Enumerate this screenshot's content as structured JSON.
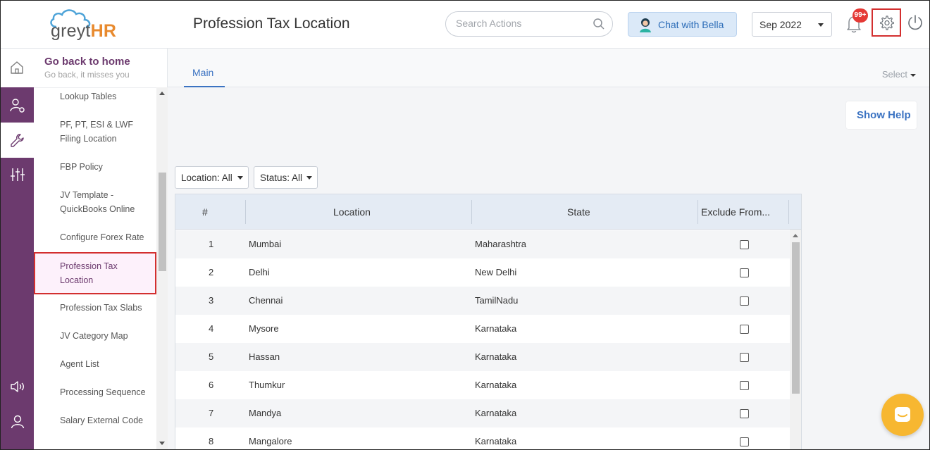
{
  "app": {
    "logo_prefix": "greyt",
    "logo_suffix": "HR",
    "page_title": "Profession Tax Location"
  },
  "header": {
    "search_placeholder": "Search Actions",
    "chat_label": "Chat with Bella",
    "period": "Sep 2022",
    "notification_count": "99+"
  },
  "subnav": {
    "home_title": "Go back to home",
    "home_subtitle": "Go back, it misses you",
    "items": [
      {
        "label": "Lookup Tables"
      },
      {
        "label": "PF, PT, ESI & LWF Filing Location"
      },
      {
        "label": "FBP Policy"
      },
      {
        "label": "JV Template - QuickBooks Online"
      },
      {
        "label": "Configure Forex Rate"
      },
      {
        "label": "Profession Tax Location"
      },
      {
        "label": "Profession Tax Slabs"
      },
      {
        "label": "JV Category Map"
      },
      {
        "label": "Agent List"
      },
      {
        "label": "Processing Sequence"
      },
      {
        "label": "Salary External Code"
      }
    ]
  },
  "tabs": {
    "main": "Main",
    "select": "Select"
  },
  "help_label": "Show Help",
  "filters": {
    "location": "Location: All",
    "status": "Status: All"
  },
  "table": {
    "headers": {
      "num": "#",
      "location": "Location",
      "state": "State",
      "exclude": "Exclude From..."
    },
    "rows": [
      {
        "num": "1",
        "location": "Mumbai",
        "state": "Maharashtra",
        "excluded": false
      },
      {
        "num": "2",
        "location": "Delhi",
        "state": "New Delhi",
        "excluded": false
      },
      {
        "num": "3",
        "location": "Chennai",
        "state": "TamilNadu",
        "excluded": false
      },
      {
        "num": "4",
        "location": "Mysore",
        "state": "Karnataka",
        "excluded": false
      },
      {
        "num": "5",
        "location": "Hassan",
        "state": "Karnataka",
        "excluded": false
      },
      {
        "num": "6",
        "location": "Thumkur",
        "state": "Karnataka",
        "excluded": false
      },
      {
        "num": "7",
        "location": "Mandya",
        "state": "Karnataka",
        "excluded": false
      },
      {
        "num": "8",
        "location": "Mangalore",
        "state": "Karnataka",
        "excluded": false
      }
    ]
  },
  "colors": {
    "brand_purple": "#6c3a6e",
    "accent_blue": "#3b73c2",
    "logo_orange": "#e88a2e",
    "highlight_red": "#d32f2f",
    "fab_yellow": "#f7b731"
  }
}
